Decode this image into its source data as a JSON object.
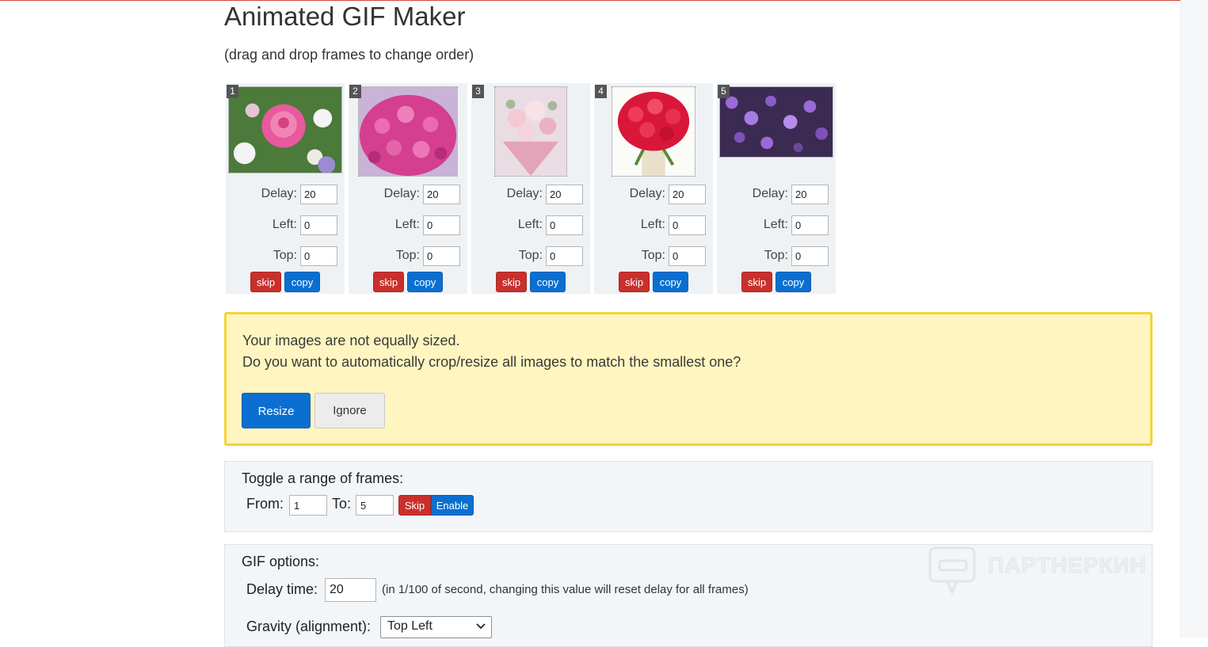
{
  "page": {
    "title": "Animated GIF Maker",
    "subtitle": "(drag and drop frames to change order)"
  },
  "frame_labels": {
    "delay": "Delay:",
    "left": "Left:",
    "top": "Top:",
    "skip": "skip",
    "copy": "copy"
  },
  "frames": [
    {
      "number": "1",
      "delay": "20",
      "left": "0",
      "top": "0",
      "image": "pink-rose-bouquet"
    },
    {
      "number": "2",
      "delay": "20",
      "left": "0",
      "top": "0",
      "image": "pink-flower-ball"
    },
    {
      "number": "3",
      "delay": "20",
      "left": "0",
      "top": "0",
      "image": "pastel-rose-bouquet"
    },
    {
      "number": "4",
      "delay": "20",
      "left": "0",
      "top": "0",
      "image": "red-rose-bouquet"
    },
    {
      "number": "5",
      "delay": "20",
      "left": "0",
      "top": "0",
      "image": "purple-flower-field"
    }
  ],
  "alert": {
    "line1": "Your images are not equally sized.",
    "line2": "Do you want to automatically crop/resize all images to match the smallest one?",
    "resize_label": "Resize",
    "ignore_label": "Ignore"
  },
  "toggle_range": {
    "title": "Toggle a range of frames:",
    "from_label": "From:",
    "from_value": "1",
    "to_label": "To:",
    "to_value": "5",
    "skip_label": "Skip",
    "enable_label": "Enable"
  },
  "gif_options": {
    "title": "GIF options:",
    "delay_label": "Delay time:",
    "delay_value": "20",
    "delay_note": "(in 1/100 of second, changing this value will reset delay for all frames)",
    "gravity_label": "Gravity (alignment):",
    "gravity_value": "Top Left"
  },
  "watermark": {
    "text": "ПАРТНЕРКИН"
  },
  "colors": {
    "danger": "#c9302c",
    "primary": "#0b6fd1",
    "alert_bg": "#fff5c0",
    "alert_border": "#f5d235",
    "panel_bg": "#f3f6f8"
  }
}
